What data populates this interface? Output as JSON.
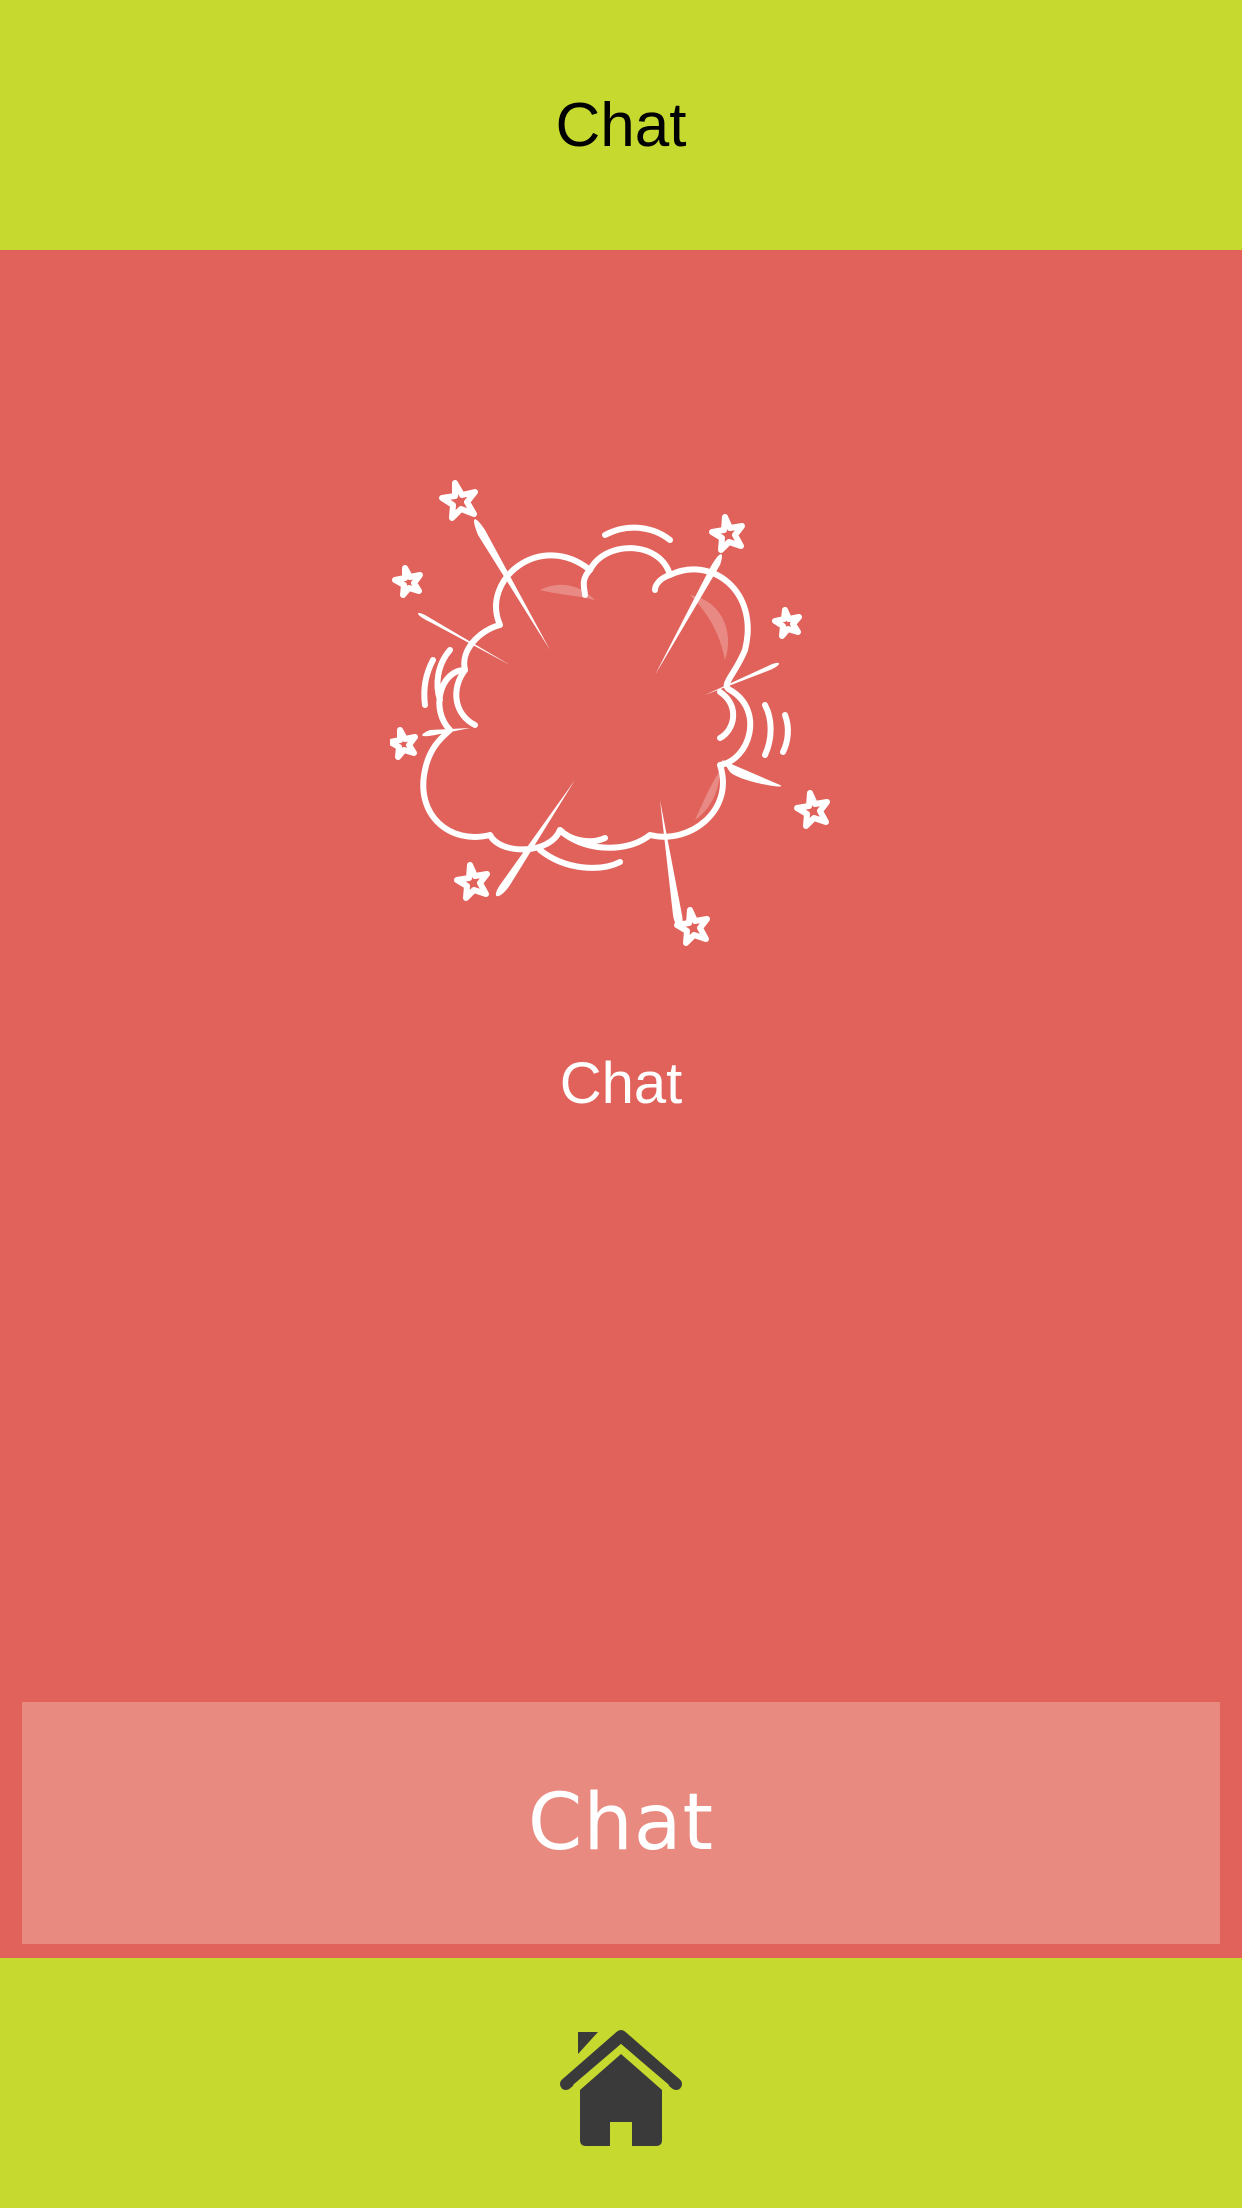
{
  "header": {
    "title": "Chat",
    "background": "#c6d92e"
  },
  "main": {
    "background": "#e0625b",
    "illustration_icon": "explosion-cloud-icon",
    "label": "Chat",
    "button_label": "Chat",
    "button_color": "#e88a7f"
  },
  "footer": {
    "background": "#c6d92e",
    "home_icon": "home-icon",
    "icon_color": "#3a3a3a"
  }
}
